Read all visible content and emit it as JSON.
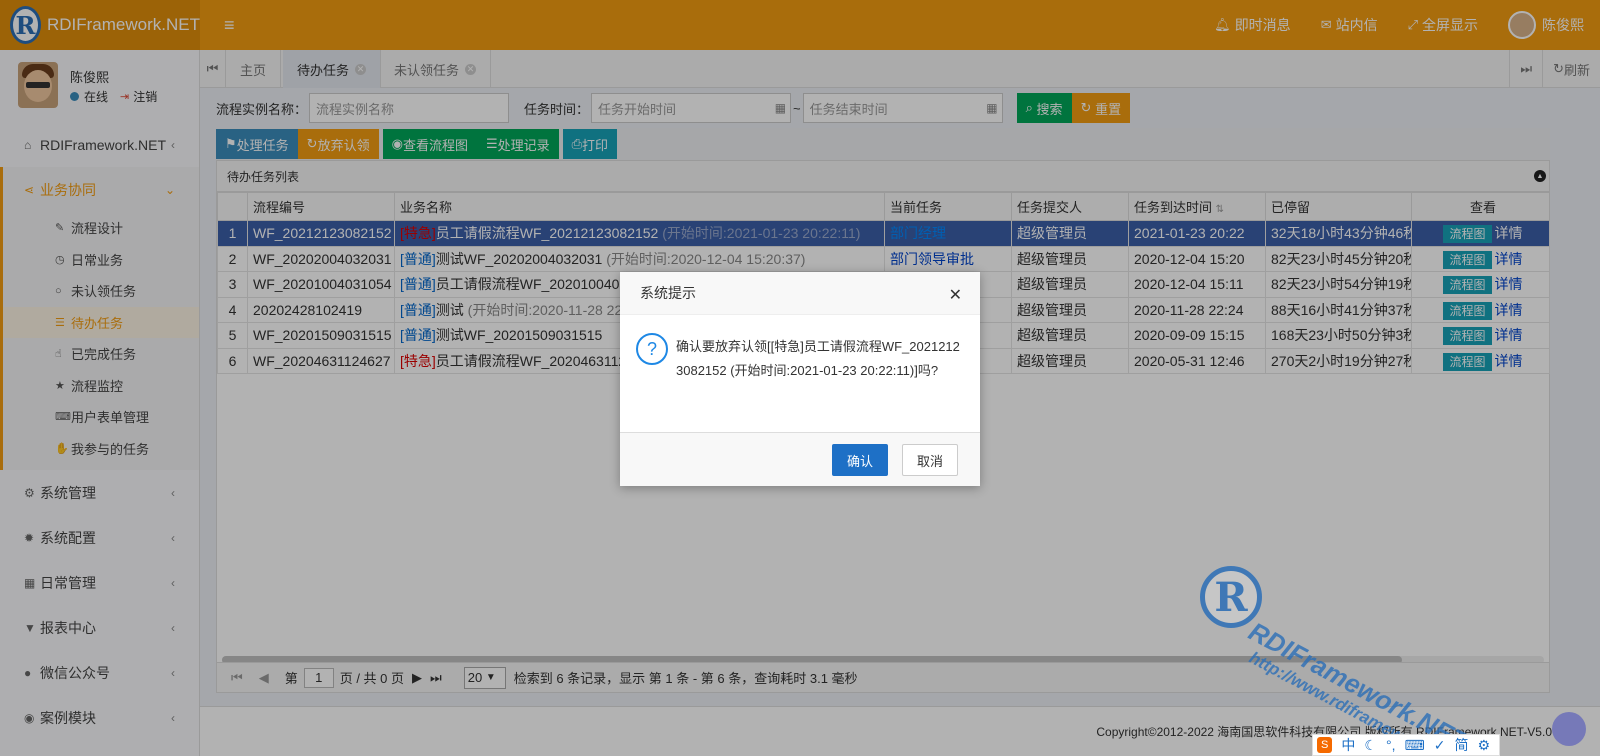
{
  "app": {
    "logo_letter": "R",
    "title": "RDIFramework.NET"
  },
  "header": {
    "toggle_icon": "menu-icon",
    "messages": "即时消息",
    "inbox": "站内信",
    "fullscreen": "全屏显示",
    "user": "陈俊熙"
  },
  "sidebar": {
    "user_name": "陈俊熙",
    "status": "在线",
    "logout": "注销",
    "menus": [
      {
        "label": "RDIFramework.NET",
        "icon": "home-icon"
      },
      {
        "label": "业务协同",
        "icon": "share-icon"
      },
      {
        "label": "系统管理",
        "icon": "cogs-icon"
      },
      {
        "label": "系统配置",
        "icon": "gear-icon"
      },
      {
        "label": "日常管理",
        "icon": "calendar-icon"
      },
      {
        "label": "报表中心",
        "icon": "filter-icon"
      },
      {
        "label": "微信公众号",
        "icon": "wechat-icon"
      },
      {
        "label": "案例模块",
        "icon": "eye-icon"
      }
    ],
    "submenus": [
      {
        "label": "流程设计",
        "icon": "edit-icon"
      },
      {
        "label": "日常业务",
        "icon": "clock-icon"
      },
      {
        "label": "未认领任务",
        "icon": "circle-icon"
      },
      {
        "label": "待办任务",
        "icon": "list-icon"
      },
      {
        "label": "已完成任务",
        "icon": "hand-icon"
      },
      {
        "label": "流程监控",
        "icon": "star-icon"
      },
      {
        "label": "用户表单管理",
        "icon": "keyboard-icon"
      },
      {
        "label": "我参与的任务",
        "icon": "hand-paper-icon"
      }
    ]
  },
  "tabs": {
    "items": [
      "主页",
      "待办任务",
      "未认领任务"
    ],
    "refresh": "刷新"
  },
  "search": {
    "name_label": "流程实例名称：",
    "name_placeholder": "流程实例名称",
    "time_label": "任务时间：",
    "start_placeholder": "任务开始时间",
    "tilde": "~",
    "end_placeholder": "任务结束时间",
    "search_btn": "搜索",
    "reset_btn": "重置"
  },
  "toolbar": {
    "process": "处理任务",
    "abandon": "放弃认领",
    "view_flow": "查看流程图",
    "records": "处理记录",
    "print": "打印"
  },
  "grid": {
    "title": "待办任务列表",
    "columns": [
      "流程编号",
      "业务名称",
      "当前任务",
      "任务提交人",
      "任务到达时间",
      "已停留",
      "查看"
    ],
    "rows": [
      {
        "no": "1",
        "code": "WF_20212123082152",
        "tag": "[特急]",
        "name": "员工请假流程WF_20212123082152",
        "time": "(开始时间:2021-01-23 20:22:11)",
        "task": "部门经理",
        "submitter": "超级管理员",
        "arrive": "2021-01-23 20:22",
        "stay": "32天18小时43分钟46秒"
      },
      {
        "no": "2",
        "code": "WF_20202004032031",
        "tag": "[普通]",
        "name": "测试WF_20202004032031",
        "time": "(开始时间:2020-12-04 15:20:37)",
        "task": "部门领导审批",
        "submitter": "超级管理员",
        "arrive": "2020-12-04 15:20",
        "stay": "82天23小时45分钟20秒"
      },
      {
        "no": "3",
        "code": "WF_20201004031054",
        "tag": "[普通]",
        "name": "员工请假流程WF_20201004031054",
        "time": "",
        "task": "",
        "submitter": "超级管理员",
        "arrive": "2020-12-04 15:11",
        "stay": "82天23小时54分钟19秒"
      },
      {
        "no": "4",
        "code": "20202428102419",
        "tag": "[普通]",
        "name": "测试",
        "time": "(开始时间:2020-11-28 22:24:19)",
        "task": "批",
        "submitter": "超级管理员",
        "arrive": "2020-11-28 22:24",
        "stay": "88天16小时41分钟37秒"
      },
      {
        "no": "5",
        "code": "WF_20201509031515",
        "tag": "[普通]",
        "name": "测试WF_20201509031515",
        "time": "",
        "task": "批",
        "submitter": "超级管理员",
        "arrive": "2020-09-09 15:15",
        "stay": "168天23小时50分钟3秒"
      },
      {
        "no": "6",
        "code": "WF_20204631124627",
        "tag": "[特急]",
        "name": "员工请假流程WF_20204631124627",
        "time": "",
        "task": "",
        "submitter": "超级管理员",
        "arrive": "2020-05-31 12:46",
        "stay": "270天2小时19分钟27秒"
      }
    ],
    "flow_btn": "流程图",
    "detail_link": "详情"
  },
  "pager": {
    "page_prefix": "第",
    "page": "1",
    "page_suffix": "页 / 共 0 页",
    "page_size": "20",
    "info": "检索到 6 条记录，显示 第 1 条 - 第 6 条，查询耗时 3.1 毫秒"
  },
  "footer": {
    "copyright": "Copyright©2012-2022 海南国思软件科技有限公司 版权所有 RDIFramework.NET-V5.0"
  },
  "dialog": {
    "title": "系统提示",
    "message": "确认要放弃认领[[特急]员工请假流程WF_20212123082152 (开始时间:2021-01-23 20:22:11)]吗?",
    "ok": "确认",
    "cancel": "取消"
  },
  "watermark": {
    "letter": "R",
    "text": "RDIFramework.NET",
    "url": "http://www.rdiframework.net"
  },
  "ime": {
    "logo": "S",
    "items": [
      "中",
      "简"
    ]
  },
  "colors": {
    "header": "#f39c12",
    "selected_row": "#3c5fa8",
    "primary": "#1e70c6"
  }
}
